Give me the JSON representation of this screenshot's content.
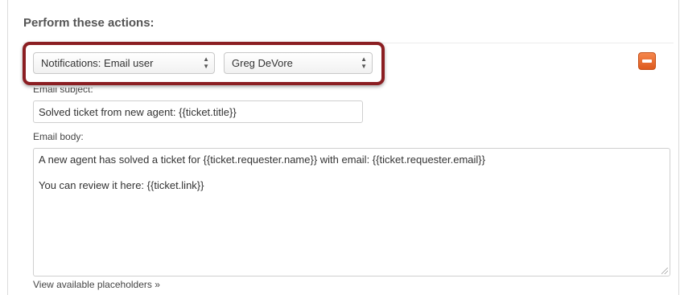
{
  "section": {
    "heading": "Perform these actions:"
  },
  "action": {
    "type_select_value": "Notifications: Email user",
    "user_select_value": "Greg DeVore",
    "remove_icon": "minus-icon"
  },
  "email": {
    "subject_label": "Email subject:",
    "subject_value": "Solved ticket from new agent: {{ticket.title}}",
    "body_label": "Email body:",
    "body_lines": [
      "A new agent has solved a ticket for {{ticket.requester.name}} with email: {{ticket.requester.email}}",
      "You can review it here: {{ticket.link}}"
    ]
  },
  "placeholders_link": "View available placeholders »",
  "colors": {
    "highlight_border": "#8b1e22",
    "remove_button": "#e8672e"
  }
}
